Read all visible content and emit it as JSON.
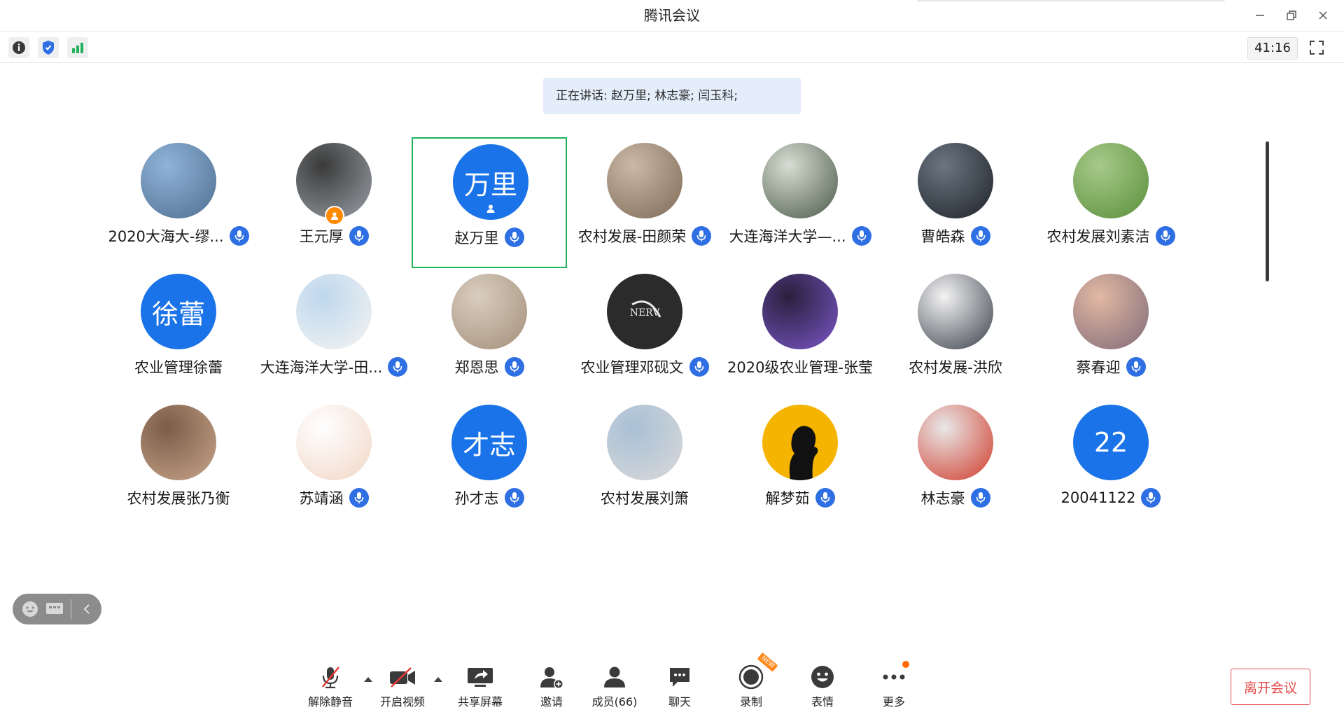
{
  "window": {
    "title": "腾讯会议"
  },
  "toolbar": {
    "timer": "41:16"
  },
  "speaking_banner": "正在讲话: 赵万里; 林志豪; 闫玉科;",
  "participants": [
    {
      "name": "2020大海大-缪...",
      "mic": true,
      "avatar": "photo-cityscape"
    },
    {
      "name": "王元厚",
      "mic": true,
      "avatar": "photo-anime-ninja",
      "host_badge": true
    },
    {
      "name": "赵万里",
      "mic": true,
      "avatar_text": "万里",
      "active": true,
      "pinned": true
    },
    {
      "name": "农村发展-田颜荣",
      "mic": true,
      "avatar": "photo-cat"
    },
    {
      "name": "大连海洋大学—...",
      "mic": true,
      "avatar": "photo-anime-boy"
    },
    {
      "name": "曹皓森",
      "mic": true,
      "avatar": "photo-silhouette"
    },
    {
      "name": "农村发展刘素洁",
      "mic": true,
      "avatar": "photo-meadow"
    },
    {
      "name": "农业管理徐蕾",
      "mic": false,
      "avatar_text": "徐蕾"
    },
    {
      "name": "大连海洋大学-田...",
      "mic": true,
      "avatar": "photo-goose"
    },
    {
      "name": "郑恩思",
      "mic": true,
      "avatar": "photo-dog"
    },
    {
      "name": "农业管理邓砚文",
      "mic": true,
      "avatar": "photo-nerv-logo"
    },
    {
      "name": "2020级农业管理-张莹",
      "mic": false,
      "avatar": "photo-neon-girl"
    },
    {
      "name": "农村发展-洪欣",
      "mic": false,
      "avatar": "photo-anime-portrait"
    },
    {
      "name": "蔡春迎",
      "mic": true,
      "avatar": "photo-sunset"
    },
    {
      "name": "农村发展张乃衡",
      "mic": false,
      "avatar": "photo-basketball"
    },
    {
      "name": "苏靖涵",
      "mic": true,
      "avatar": "sticker-cartoon"
    },
    {
      "name": "孙才志",
      "mic": true,
      "avatar_text": "才志"
    },
    {
      "name": "农村发展刘箫",
      "mic": false,
      "avatar": "photo-boy-sitting"
    },
    {
      "name": "解梦茹",
      "mic": true,
      "avatar": "silhouette-yellow"
    },
    {
      "name": "林志豪",
      "mic": true,
      "avatar": "anime-redhead"
    },
    {
      "name": "20041122",
      "mic": true,
      "avatar_text": "22"
    }
  ],
  "bottom": {
    "unmute": "解除静音",
    "video": "开启视频",
    "share": "共享屏幕",
    "invite": "邀请",
    "members": "成员(66)",
    "chat": "聊天",
    "record": "录制",
    "reactions": "表情",
    "more": "更多",
    "leave": "离开会议"
  },
  "colors": {
    "accent": "#1a73e8",
    "active_border": "#20b35a",
    "leave": "#e34a4a"
  }
}
